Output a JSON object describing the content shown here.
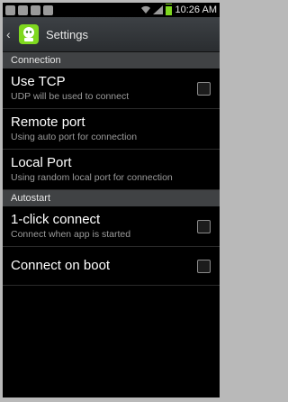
{
  "status_bar": {
    "time": "10:26 AM"
  },
  "action_bar": {
    "back_icon": "chevron-left-icon",
    "app_icon": "app-logo-icon",
    "title": "Settings"
  },
  "sections": {
    "connection": {
      "header": "Connection",
      "use_tcp": {
        "title": "Use TCP",
        "summary": "UDP will be used to connect",
        "checked": false
      },
      "remote_port": {
        "title": "Remote port",
        "summary": "Using auto port for connection"
      },
      "local_port": {
        "title": "Local Port",
        "summary": "Using random local port for connection"
      }
    },
    "autostart": {
      "header": "Autostart",
      "one_click": {
        "title": "1-click connect",
        "summary": "Connect when app is started",
        "checked": false
      },
      "connect_on_boot": {
        "title": "Connect on boot",
        "checked": false
      }
    }
  },
  "colors": {
    "accent_green": "#7fd81f",
    "background": "#000000",
    "section_header": "#404244"
  }
}
